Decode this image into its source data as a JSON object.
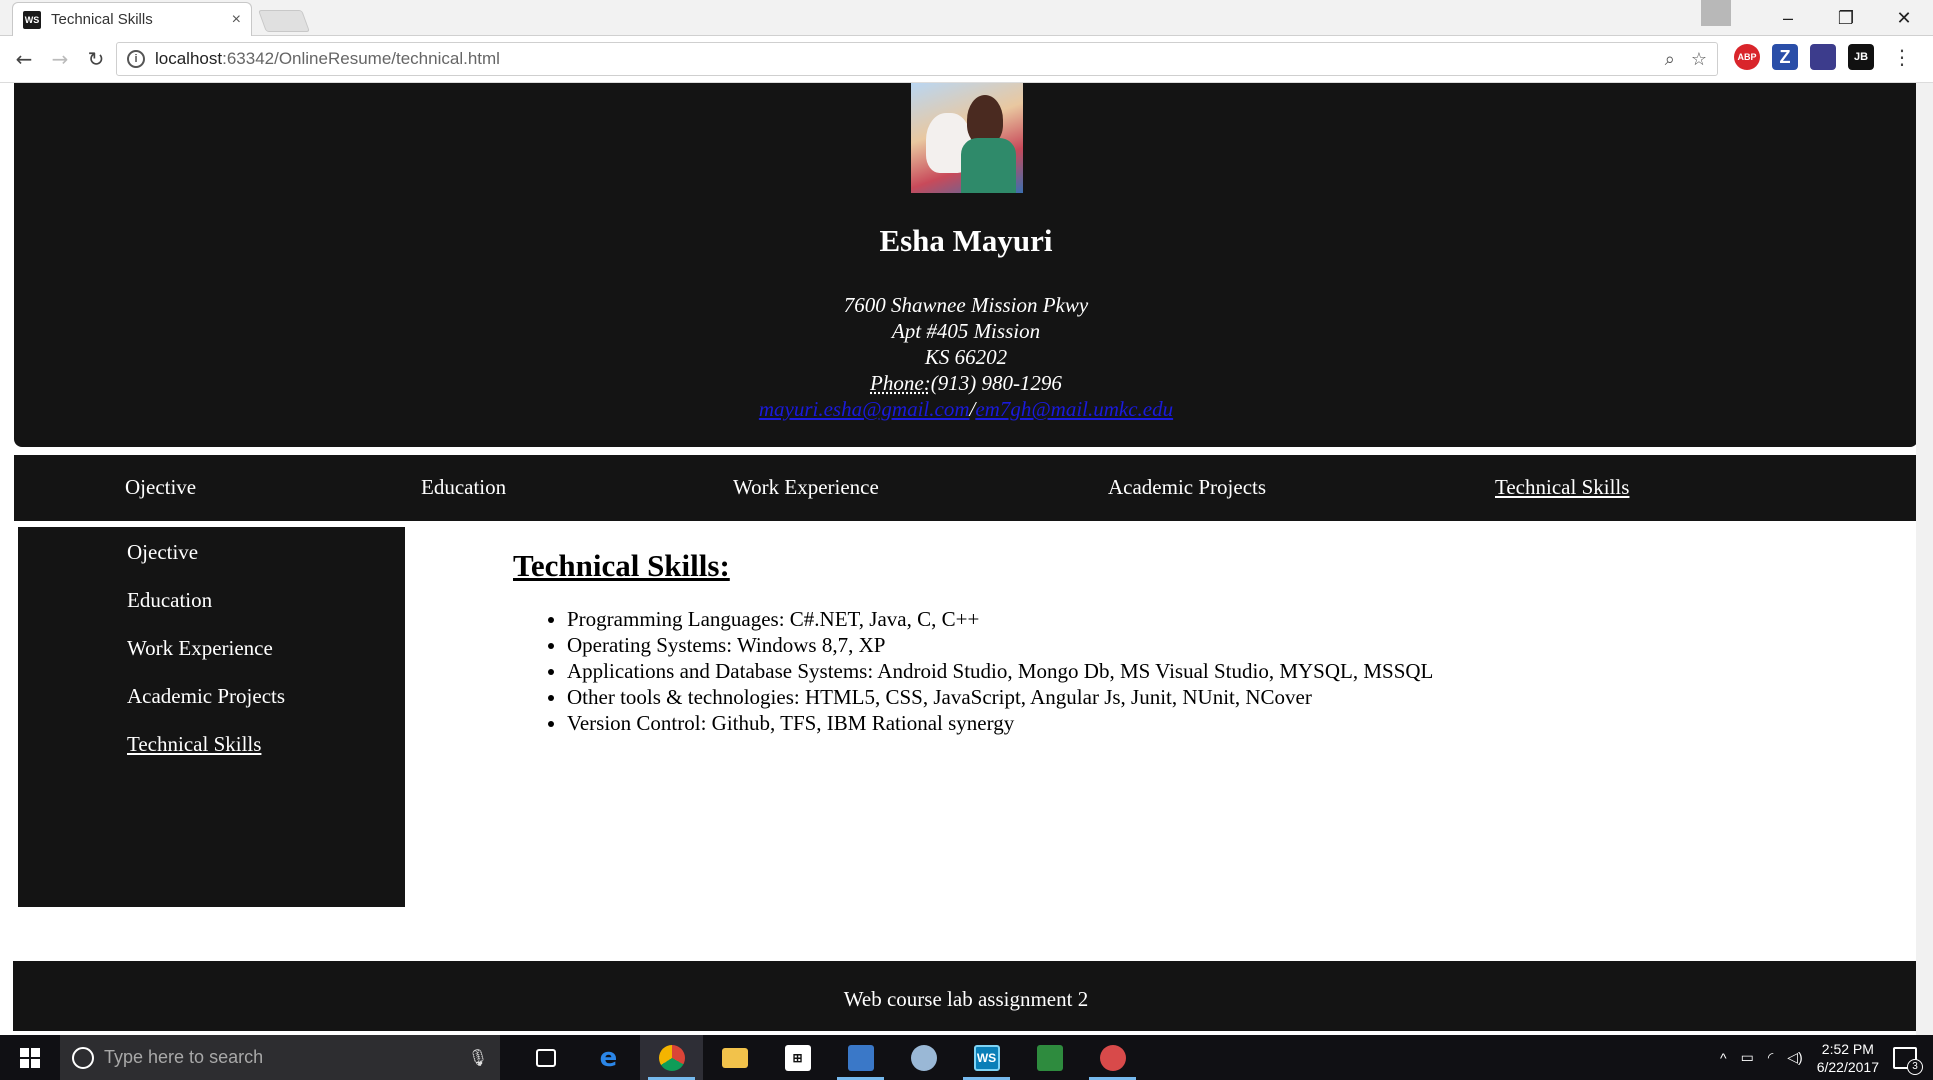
{
  "browser": {
    "tab_title": "Technical Skills",
    "tab_close": "×",
    "url_host": "localhost",
    "url_rest": ":63342/OnlineResume/technical.html",
    "window_buttons": [
      "–",
      "❐",
      "✕"
    ],
    "extensions": [
      "ABP",
      "Z",
      "",
      "JB"
    ]
  },
  "header": {
    "name": "Esha Mayuri",
    "address_line1": "7600 Shawnee Mission Pkwy",
    "address_line2": "Apt #405 Mission",
    "address_line3": "KS 66202",
    "phone_label": "Phone:",
    "phone": "(913) 980-1296",
    "email1": "mayuri.esha@gmail.com",
    "email_sep": "/",
    "email2": "em7gh@mail.umkc.edu"
  },
  "topnav": {
    "items": [
      "Ojective",
      "Education",
      "Work Experience",
      "Academic Projects",
      "Technical Skills"
    ]
  },
  "sidebar": {
    "items": [
      "Ojective",
      "Education",
      "Work Experience",
      "Academic Projects",
      "Technical Skills"
    ]
  },
  "main": {
    "heading": "Technical Skills:",
    "skills": [
      "Programming Languages: C#.NET, Java, C, C++",
      "Operating Systems: Windows 8,7, XP",
      "Applications and Database Systems: Android Studio, Mongo Db, MS Visual Studio, MYSQL, MSSQL",
      "Other tools & technologies: HTML5, CSS, JavaScript, Angular Js, Junit, NUnit, NCover",
      "Version Control: Github, TFS, IBM Rational synergy"
    ]
  },
  "footer": {
    "text": "Web course lab assignment 2"
  },
  "taskbar": {
    "search_placeholder": "Type here to search",
    "time": "2:52 PM",
    "date": "6/22/2017",
    "notification_count": "3"
  },
  "colors": {
    "panel_bg": "#141414",
    "link": "#1a1adc"
  }
}
